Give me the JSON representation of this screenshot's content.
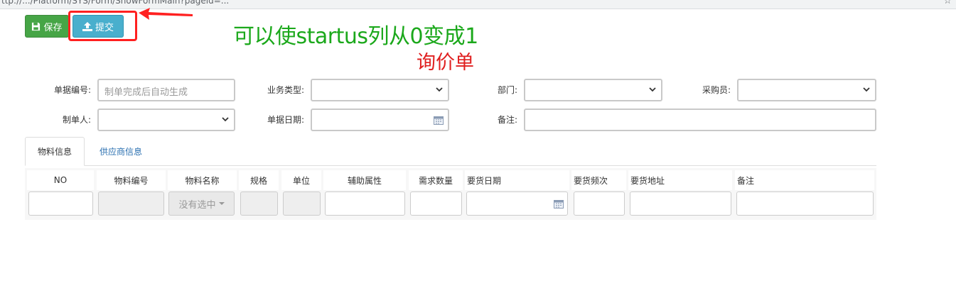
{
  "browser": {
    "url": "ttp://.../Platform/SYS/Form/ShowFormMain?pageid=...",
    "star": "☆"
  },
  "toolbar": {
    "save_label": "保存",
    "submit_label": "提交"
  },
  "annotations": {
    "green_note": "可以使startus列从0变成1",
    "red_title": "询价单",
    "green_color": "#1ba81b",
    "red_color": "#e02020"
  },
  "form": {
    "doc_no_label": "单据编号:",
    "doc_no_placeholder": "制单完成后自动生成",
    "biz_type_label": "业务类型:",
    "dept_label": "部门:",
    "buyer_label": "采购员:",
    "maker_label": "制单人:",
    "doc_date_label": "单据日期:",
    "remark_label": "备注:"
  },
  "tabs": [
    {
      "label": "物料信息",
      "active": true
    },
    {
      "label": "供应商信息",
      "active": false
    }
  ],
  "grid": {
    "columns": [
      "NO",
      "物料编号",
      "物料名称",
      "规格",
      "单位",
      "辅助属性",
      "需求数量",
      "要货日期",
      "要货频次",
      "要货地址",
      "备注"
    ],
    "material_name_placeholder": "没有选中"
  },
  "colors": {
    "save_button": "#46a546",
    "submit_button": "#49afcd",
    "highlight": "#ff2020",
    "tab_link": "#2a6fb0"
  }
}
